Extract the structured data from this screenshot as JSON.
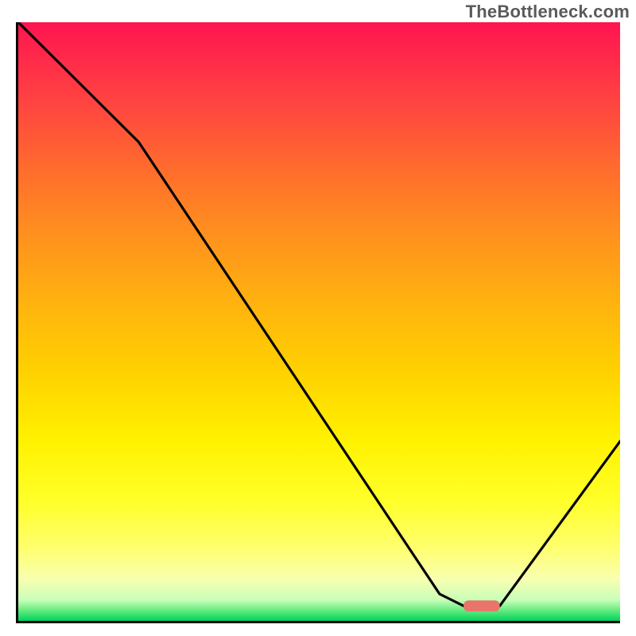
{
  "watermark": "TheBottleneck.com",
  "chart_data": {
    "type": "line",
    "title": "",
    "xlabel": "",
    "ylabel": "",
    "xlim": [
      0,
      100
    ],
    "ylim": [
      0,
      100
    ],
    "x": [
      0,
      20,
      70,
      74,
      80,
      100
    ],
    "y": [
      100,
      80,
      4.5,
      2.5,
      2.5,
      30
    ],
    "marker": {
      "x_start": 74,
      "x_end": 80,
      "y": 2.5
    },
    "gradient_stops": [
      {
        "pos": 0,
        "color": "#ff1450"
      },
      {
        "pos": 0.06,
        "color": "#ff2a4a"
      },
      {
        "pos": 0.14,
        "color": "#ff4640"
      },
      {
        "pos": 0.24,
        "color": "#ff6a2e"
      },
      {
        "pos": 0.34,
        "color": "#ff8c20"
      },
      {
        "pos": 0.46,
        "color": "#ffb010"
      },
      {
        "pos": 0.58,
        "color": "#ffd000"
      },
      {
        "pos": 0.7,
        "color": "#fff200"
      },
      {
        "pos": 0.8,
        "color": "#ffff2a"
      },
      {
        "pos": 0.88,
        "color": "#ffff70"
      },
      {
        "pos": 0.93,
        "color": "#f8ffb0"
      },
      {
        "pos": 0.965,
        "color": "#c9ffb9"
      },
      {
        "pos": 0.985,
        "color": "#55e878"
      },
      {
        "pos": 1.0,
        "color": "#00d060"
      }
    ]
  }
}
